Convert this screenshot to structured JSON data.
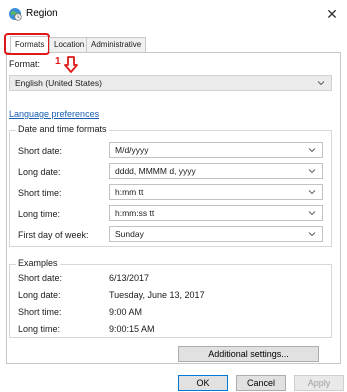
{
  "window": {
    "title": "Region",
    "icon": "globe-clock-icon",
    "close_glyph": "✕"
  },
  "tabs": [
    {
      "label": "Formats",
      "active": true
    },
    {
      "label": "Location",
      "active": false
    },
    {
      "label": "Administrative",
      "active": false
    }
  ],
  "annotation": {
    "number": "1",
    "color": "#e01818"
  },
  "format": {
    "label": "Format:",
    "value": "English (United States)"
  },
  "language_link": "Language preferences",
  "date_time": {
    "title": "Date and time formats",
    "rows": [
      {
        "label": "Short date:",
        "value": "M/d/yyyy"
      },
      {
        "label": "Long date:",
        "value": "dddd, MMMM d, yyyy"
      },
      {
        "label": "Short time:",
        "value": "h:mm tt"
      },
      {
        "label": "Long time:",
        "value": "h:mm:ss tt"
      },
      {
        "label": "First day of week:",
        "value": "Sunday"
      }
    ]
  },
  "examples": {
    "title": "Examples",
    "rows": [
      {
        "label": "Short date:",
        "value": "6/13/2017"
      },
      {
        "label": "Long date:",
        "value": "Tuesday, June 13, 2017"
      },
      {
        "label": "Short time:",
        "value": "9:00 AM"
      },
      {
        "label": "Long time:",
        "value": "9:00:15 AM"
      }
    ]
  },
  "buttons": {
    "additional": "Additional settings...",
    "ok": "OK",
    "cancel": "Cancel",
    "apply": "Apply"
  },
  "colors": {
    "link": "#1a5fb4",
    "highlight": "#e01818",
    "accent": "#0078d7"
  }
}
